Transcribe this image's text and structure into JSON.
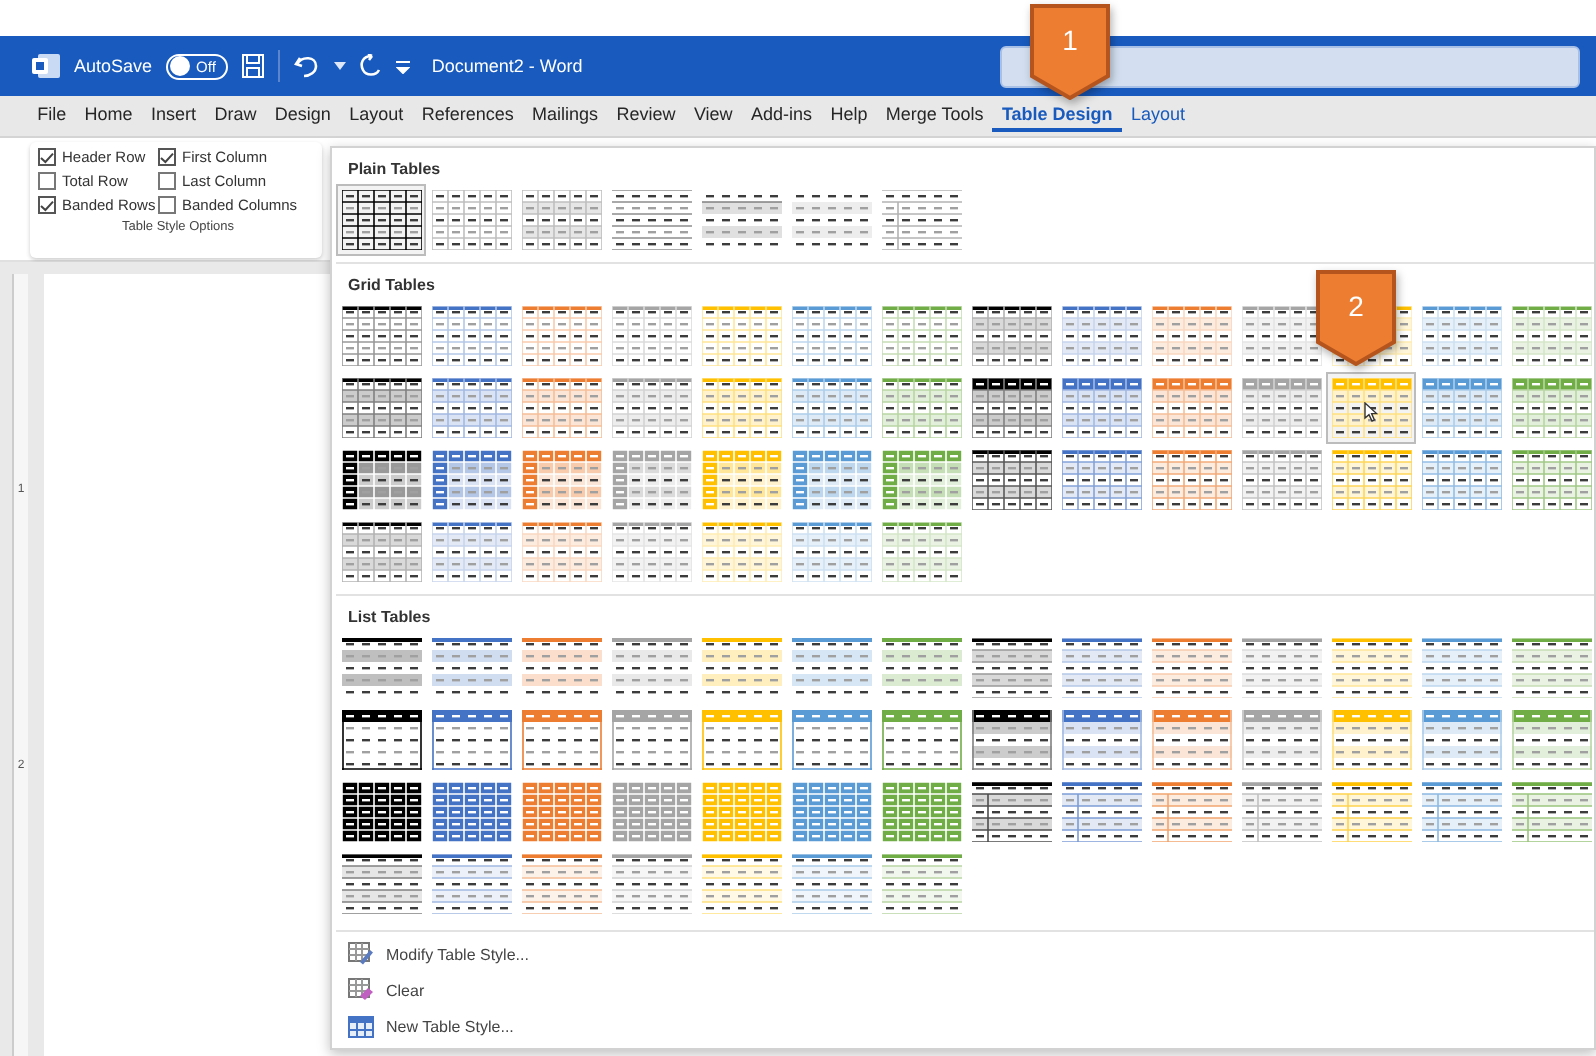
{
  "title_bar": {
    "autosave_label": "AutoSave",
    "autosave": {
      "on": false,
      "label": "Off"
    },
    "document_title": "Document2  -  Word"
  },
  "menu_tabs": [
    {
      "label": "File",
      "kind": "standard",
      "selected": false
    },
    {
      "label": "Home",
      "kind": "standard",
      "selected": false
    },
    {
      "label": "Insert",
      "kind": "standard",
      "selected": false
    },
    {
      "label": "Draw",
      "kind": "standard",
      "selected": false
    },
    {
      "label": "Design",
      "kind": "standard",
      "selected": false
    },
    {
      "label": "Layout",
      "kind": "standard",
      "selected": false
    },
    {
      "label": "References",
      "kind": "standard",
      "selected": false
    },
    {
      "label": "Mailings",
      "kind": "standard",
      "selected": false
    },
    {
      "label": "Review",
      "kind": "standard",
      "selected": false
    },
    {
      "label": "View",
      "kind": "standard",
      "selected": false
    },
    {
      "label": "Add-ins",
      "kind": "standard",
      "selected": false
    },
    {
      "label": "Help",
      "kind": "standard",
      "selected": false
    },
    {
      "label": "Merge Tools",
      "kind": "standard",
      "selected": false
    },
    {
      "label": "Table Design",
      "kind": "contextual",
      "selected": true
    },
    {
      "label": "Layout",
      "kind": "contextual",
      "selected": false
    }
  ],
  "table_style_options": {
    "title": "Table Style Options",
    "options": [
      {
        "label": "Header Row",
        "checked": true
      },
      {
        "label": "First Column",
        "checked": true
      },
      {
        "label": "Total Row",
        "checked": false
      },
      {
        "label": "Last Column",
        "checked": false
      },
      {
        "label": "Banded Rows",
        "checked": true
      },
      {
        "label": "Banded Columns",
        "checked": false
      }
    ]
  },
  "ruler_labels": [
    "1",
    "2"
  ],
  "gallery": {
    "sections": [
      {
        "title": "Plain Tables",
        "styles": [
          {
            "kind": "plain-grid",
            "selected": true
          },
          {
            "kind": "plain-light-grid",
            "selected": false
          },
          {
            "kind": "plain-banded-grid",
            "selected": false
          },
          {
            "kind": "plain-rules",
            "selected": false
          },
          {
            "kind": "plain-banded",
            "selected": false
          },
          {
            "kind": "plain-banded-light",
            "selected": false
          },
          {
            "kind": "plain-first-col",
            "selected": false
          }
        ]
      },
      {
        "title": "Grid Tables",
        "styles": [
          {
            "kind": "grid-1",
            "color": "#000000",
            "selected": false
          },
          {
            "kind": "grid-1",
            "color": "#4472c4",
            "selected": false
          },
          {
            "kind": "grid-1",
            "color": "#ed7d31",
            "selected": false
          },
          {
            "kind": "grid-1",
            "color": "#a5a5a5",
            "selected": false
          },
          {
            "kind": "grid-1",
            "color": "#ffc000",
            "selected": false
          },
          {
            "kind": "grid-1",
            "color": "#5b9bd5",
            "selected": false
          },
          {
            "kind": "grid-1",
            "color": "#70ad47",
            "selected": false
          },
          {
            "kind": "grid-2",
            "color": "#000000",
            "selected": false
          },
          {
            "kind": "grid-2",
            "color": "#4472c4",
            "selected": false
          },
          {
            "kind": "grid-2",
            "color": "#ed7d31",
            "selected": false
          },
          {
            "kind": "grid-2",
            "color": "#a5a5a5",
            "selected": false
          },
          {
            "kind": "grid-2",
            "color": "#ffc000",
            "selected": false
          },
          {
            "kind": "grid-2",
            "color": "#5b9bd5",
            "selected": false
          },
          {
            "kind": "grid-2",
            "color": "#70ad47",
            "selected": false
          },
          {
            "kind": "grid-3",
            "color": "#000000",
            "selected": false
          },
          {
            "kind": "grid-3",
            "color": "#4472c4",
            "selected": false
          },
          {
            "kind": "grid-3",
            "color": "#ed7d31",
            "selected": false
          },
          {
            "kind": "grid-3",
            "color": "#a5a5a5",
            "selected": false
          },
          {
            "kind": "grid-3",
            "color": "#ffc000",
            "selected": false
          },
          {
            "kind": "grid-3",
            "color": "#5b9bd5",
            "selected": false
          },
          {
            "kind": "grid-3",
            "color": "#70ad47",
            "selected": false
          },
          {
            "kind": "grid-4",
            "color": "#000000",
            "selected": false
          },
          {
            "kind": "grid-4",
            "color": "#4472c4",
            "selected": false
          },
          {
            "kind": "grid-4",
            "color": "#ed7d31",
            "selected": false
          },
          {
            "kind": "grid-4",
            "color": "#a5a5a5",
            "selected": false
          },
          {
            "kind": "grid-4",
            "color": "#ffc000",
            "selected": true
          },
          {
            "kind": "grid-4",
            "color": "#5b9bd5",
            "selected": false
          },
          {
            "kind": "grid-4",
            "color": "#70ad47",
            "selected": false
          },
          {
            "kind": "grid-5",
            "color": "#000000",
            "selected": false
          },
          {
            "kind": "grid-5",
            "color": "#4472c4",
            "selected": false
          },
          {
            "kind": "grid-5",
            "color": "#ed7d31",
            "selected": false
          },
          {
            "kind": "grid-5",
            "color": "#a5a5a5",
            "selected": false
          },
          {
            "kind": "grid-5",
            "color": "#ffc000",
            "selected": false
          },
          {
            "kind": "grid-5",
            "color": "#5b9bd5",
            "selected": false
          },
          {
            "kind": "grid-5",
            "color": "#70ad47",
            "selected": false
          },
          {
            "kind": "grid-6",
            "color": "#000000",
            "selected": false
          },
          {
            "kind": "grid-6",
            "color": "#4472c4",
            "selected": false
          },
          {
            "kind": "grid-6",
            "color": "#ed7d31",
            "selected": false
          },
          {
            "kind": "grid-6",
            "color": "#a5a5a5",
            "selected": false
          },
          {
            "kind": "grid-6",
            "color": "#ffc000",
            "selected": false
          },
          {
            "kind": "grid-6",
            "color": "#5b9bd5",
            "selected": false
          },
          {
            "kind": "grid-6",
            "color": "#70ad47",
            "selected": false
          },
          {
            "kind": "grid-7",
            "color": "#000000",
            "selected": false
          },
          {
            "kind": "grid-7",
            "color": "#4472c4",
            "selected": false
          },
          {
            "kind": "grid-7",
            "color": "#ed7d31",
            "selected": false
          },
          {
            "kind": "grid-7",
            "color": "#a5a5a5",
            "selected": false
          },
          {
            "kind": "grid-7",
            "color": "#ffc000",
            "selected": false
          },
          {
            "kind": "grid-7",
            "color": "#5b9bd5",
            "selected": false
          },
          {
            "kind": "grid-7",
            "color": "#70ad47",
            "selected": false
          }
        ]
      },
      {
        "title": "List Tables",
        "styles": [
          {
            "kind": "list-1",
            "color": "#000000",
            "selected": false
          },
          {
            "kind": "list-1",
            "color": "#4472c4",
            "selected": false
          },
          {
            "kind": "list-1",
            "color": "#ed7d31",
            "selected": false
          },
          {
            "kind": "list-1",
            "color": "#a5a5a5",
            "selected": false
          },
          {
            "kind": "list-1",
            "color": "#ffc000",
            "selected": false
          },
          {
            "kind": "list-1",
            "color": "#5b9bd5",
            "selected": false
          },
          {
            "kind": "list-1",
            "color": "#70ad47",
            "selected": false
          },
          {
            "kind": "list-2",
            "color": "#000000",
            "selected": false
          },
          {
            "kind": "list-2",
            "color": "#4472c4",
            "selected": false
          },
          {
            "kind": "list-2",
            "color": "#ed7d31",
            "selected": false
          },
          {
            "kind": "list-2",
            "color": "#a5a5a5",
            "selected": false
          },
          {
            "kind": "list-2",
            "color": "#ffc000",
            "selected": false
          },
          {
            "kind": "list-2",
            "color": "#5b9bd5",
            "selected": false
          },
          {
            "kind": "list-2",
            "color": "#70ad47",
            "selected": false
          },
          {
            "kind": "list-3",
            "color": "#000000",
            "selected": false
          },
          {
            "kind": "list-3",
            "color": "#4472c4",
            "selected": false
          },
          {
            "kind": "list-3",
            "color": "#ed7d31",
            "selected": false
          },
          {
            "kind": "list-3",
            "color": "#a5a5a5",
            "selected": false
          },
          {
            "kind": "list-3",
            "color": "#ffc000",
            "selected": false
          },
          {
            "kind": "list-3",
            "color": "#5b9bd5",
            "selected": false
          },
          {
            "kind": "list-3",
            "color": "#70ad47",
            "selected": false
          },
          {
            "kind": "list-4",
            "color": "#000000",
            "selected": false
          },
          {
            "kind": "list-4",
            "color": "#4472c4",
            "selected": false
          },
          {
            "kind": "list-4",
            "color": "#ed7d31",
            "selected": false
          },
          {
            "kind": "list-4",
            "color": "#a5a5a5",
            "selected": false
          },
          {
            "kind": "list-4",
            "color": "#ffc000",
            "selected": false
          },
          {
            "kind": "list-4",
            "color": "#5b9bd5",
            "selected": false
          },
          {
            "kind": "list-4",
            "color": "#70ad47",
            "selected": false
          },
          {
            "kind": "list-5",
            "color": "#000000",
            "selected": false
          },
          {
            "kind": "list-5",
            "color": "#4472c4",
            "selected": false
          },
          {
            "kind": "list-5",
            "color": "#ed7d31",
            "selected": false
          },
          {
            "kind": "list-5",
            "color": "#a5a5a5",
            "selected": false
          },
          {
            "kind": "list-5",
            "color": "#ffc000",
            "selected": false
          },
          {
            "kind": "list-5",
            "color": "#5b9bd5",
            "selected": false
          },
          {
            "kind": "list-5",
            "color": "#70ad47",
            "selected": false
          },
          {
            "kind": "list-6",
            "color": "#000000",
            "selected": false
          },
          {
            "kind": "list-6",
            "color": "#4472c4",
            "selected": false
          },
          {
            "kind": "list-6",
            "color": "#ed7d31",
            "selected": false
          },
          {
            "kind": "list-6",
            "color": "#a5a5a5",
            "selected": false
          },
          {
            "kind": "list-6",
            "color": "#ffc000",
            "selected": false
          },
          {
            "kind": "list-6",
            "color": "#5b9bd5",
            "selected": false
          },
          {
            "kind": "list-6",
            "color": "#70ad47",
            "selected": false
          },
          {
            "kind": "list-7",
            "color": "#000000",
            "selected": false
          },
          {
            "kind": "list-7",
            "color": "#4472c4",
            "selected": false
          },
          {
            "kind": "list-7",
            "color": "#ed7d31",
            "selected": false
          },
          {
            "kind": "list-7",
            "color": "#a5a5a5",
            "selected": false
          },
          {
            "kind": "list-7",
            "color": "#ffc000",
            "selected": false
          },
          {
            "kind": "list-7",
            "color": "#5b9bd5",
            "selected": false
          },
          {
            "kind": "list-7",
            "color": "#70ad47",
            "selected": false
          }
        ]
      }
    ],
    "actions": [
      {
        "kind": "modify",
        "label": "Modify Table Style..."
      },
      {
        "kind": "clear",
        "label": "Clear"
      },
      {
        "kind": "new",
        "label": "New Table Style..."
      }
    ]
  },
  "callouts": [
    {
      "label": "1"
    },
    {
      "label": "2"
    }
  ]
}
